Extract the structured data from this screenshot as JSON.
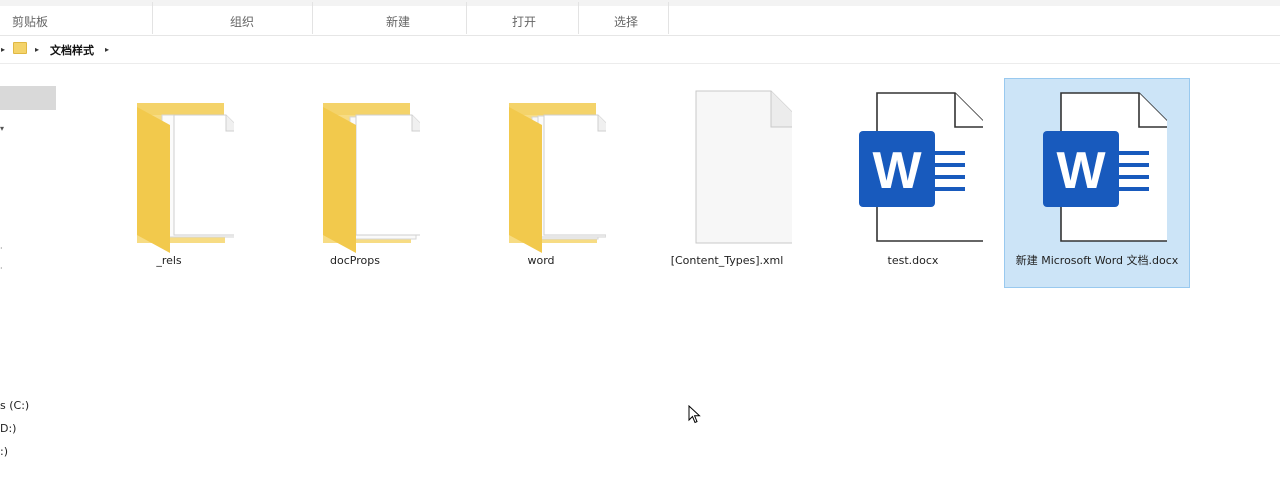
{
  "ribbon": {
    "groups": [
      "剪贴板",
      "组织",
      "新建",
      "打开",
      "选择"
    ]
  },
  "address": {
    "crumb": "文档样式"
  },
  "nav": {
    "drives": [
      "s (C:)",
      "D:)",
      ":)"
    ]
  },
  "files": [
    {
      "name": "_rels",
      "type": "folder",
      "icon": "folder-icon"
    },
    {
      "name": "docProps",
      "type": "folder",
      "icon": "folder-icon"
    },
    {
      "name": "word",
      "type": "folder",
      "icon": "folder-icon"
    },
    {
      "name": "[Content_Types].xml",
      "type": "file",
      "icon": "blank-file-icon"
    },
    {
      "name": "test.docx",
      "type": "docx",
      "icon": "word-doc-icon"
    },
    {
      "name": "新建 Microsoft Word 文档.docx",
      "type": "docx",
      "icon": "word-doc-icon",
      "selected": true
    }
  ],
  "colors": {
    "folder": "#f4d36a",
    "word_blue": "#185abd",
    "selection": "#cce4f7"
  }
}
